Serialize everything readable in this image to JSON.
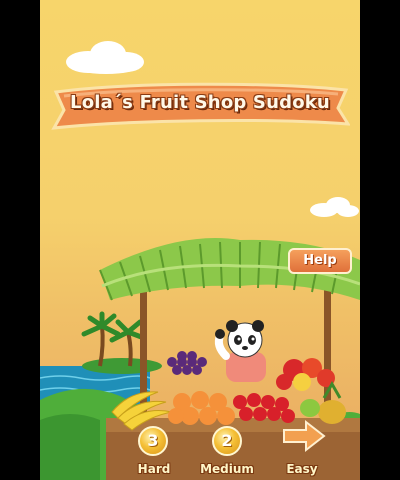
{
  "title": "Lola´s Fruit Shop Sudoku",
  "help_label": "Help",
  "levels": [
    {
      "badge": "3",
      "label": "Hard"
    },
    {
      "badge": "2",
      "label": "Medium"
    },
    {
      "badge": "",
      "label": "Easy"
    }
  ],
  "colors": {
    "sky": "#f5d06c",
    "banner": "#ee8a4a",
    "help_button": "#e8843f",
    "coin": "#f5c036",
    "sea": "#1f8fb8"
  },
  "icons": [
    "cloud-icon",
    "panda-icon",
    "palm-tree-icon",
    "arrow-right-icon",
    "banana-icon",
    "strawberry-icon",
    "orange-icon",
    "grape-icon",
    "apple-icon",
    "pineapple-icon"
  ]
}
